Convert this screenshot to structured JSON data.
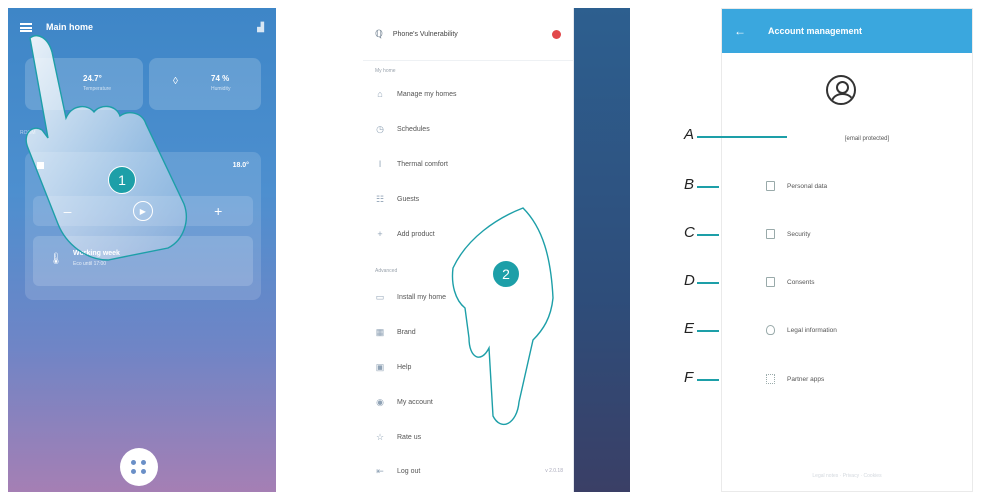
{
  "panel1": {
    "title": "Main home",
    "tile_temp": {
      "value": "24.7°",
      "sub": "Temperature"
    },
    "tile_hum": {
      "value": "74 %",
      "sub": "Humidity"
    },
    "section_label": "ROOM",
    "room_temp": "18.0°",
    "ctrl_minus": "–",
    "ctrl_plus": "+",
    "mode_title": "Working week",
    "mode_sub": "Eco until 17:00",
    "step_number": "1"
  },
  "panel2": {
    "user_name": "Phone's Vulnerability",
    "section_home": "My home",
    "section_advanced": "Advanced",
    "items_top": [
      {
        "label": "Manage my homes",
        "icon": "home-icon"
      },
      {
        "label": "Schedules",
        "icon": "schedule-icon"
      },
      {
        "label": "Thermal comfort",
        "icon": "thermometer-icon"
      },
      {
        "label": "Guests",
        "icon": "guests-icon"
      },
      {
        "label": "Add product",
        "icon": "plus-icon"
      }
    ],
    "items_advanced": [
      {
        "label": "Install my home",
        "icon": "install-icon"
      },
      {
        "label": "Brand",
        "icon": "brand-icon"
      },
      {
        "label": "Help",
        "icon": "help-icon"
      },
      {
        "label": "My account",
        "icon": "account-icon"
      },
      {
        "label": "Rate us",
        "icon": "star-icon"
      },
      {
        "label": "Log out",
        "icon": "logout-icon"
      }
    ],
    "version": "v 2.0.18",
    "step_number": "2"
  },
  "panel3": {
    "title": "Account management",
    "email": "[email protected]",
    "rows": [
      {
        "letter": "B",
        "label": "Personal data",
        "icon": "personal-data-icon"
      },
      {
        "letter": "C",
        "label": "Security",
        "icon": "security-icon"
      },
      {
        "letter": "D",
        "label": "Consents",
        "icon": "consents-icon"
      },
      {
        "letter": "E",
        "label": "Legal information",
        "icon": "legal-icon"
      },
      {
        "letter": "F",
        "label": "Partner apps",
        "icon": "partner-apps-icon"
      }
    ],
    "email_letter": "A",
    "footer": "Legal notes · Privacy · Cookies"
  },
  "colors": {
    "accent": "#1d9fa8",
    "header_blue": "#3aa7de",
    "badge_red": "#e2484b"
  }
}
